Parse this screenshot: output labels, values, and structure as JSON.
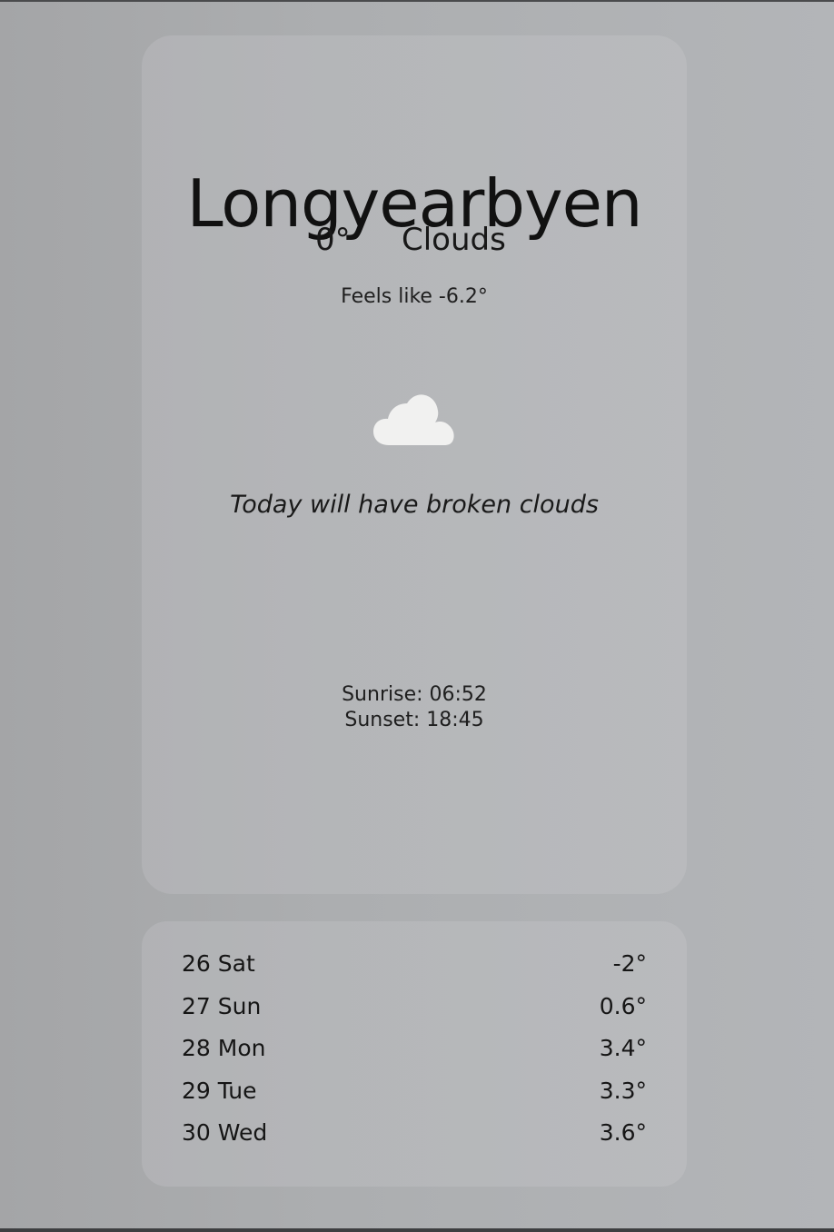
{
  "current": {
    "city": "Longyearbyen",
    "temperature": "0°",
    "condition": "Clouds",
    "feels_like": "Feels like -6.2°",
    "icon": "cloud-icon",
    "description": "Today will have broken clouds",
    "sunrise": "Sunrise: 06:52",
    "sunset": "Sunset: 18:45"
  },
  "forecast": [
    {
      "day": "26 Sat",
      "temp": "-2°"
    },
    {
      "day": "27 Sun",
      "temp": "0.6°"
    },
    {
      "day": "28 Mon",
      "temp": "3.4°"
    },
    {
      "day": "29 Tue",
      "temp": "3.3°"
    },
    {
      "day": "30 Wed",
      "temp": "3.6°"
    }
  ]
}
